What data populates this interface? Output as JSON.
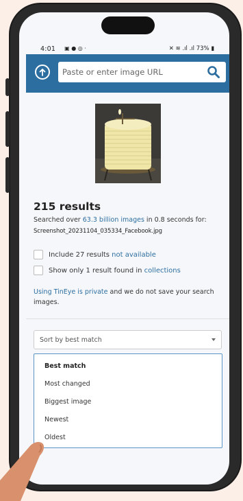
{
  "status_bar": {
    "time": "4:01",
    "battery": "73%"
  },
  "search": {
    "placeholder": "Paste or enter image URL"
  },
  "results": {
    "count_title": "215 results",
    "searched_prefix": "Searched over ",
    "images_link": "63.3 billion images",
    "searched_suffix": " in 0.8 seconds for:",
    "filename": "Screenshot_20231104_035334_Facebook.jpg"
  },
  "filters": {
    "include_prefix": "Include 27 results ",
    "include_link": "not available",
    "only_prefix": "Show only 1 result found in ",
    "only_link": "collections"
  },
  "privacy": {
    "link": "Using TinEye is private",
    "text": " and we do not save your search images."
  },
  "sort": {
    "selected": "Sort by best match",
    "options": [
      "Best match",
      "Most changed",
      "Biggest image",
      "Newest",
      "Oldest"
    ]
  },
  "colors": {
    "accent": "#2d6ea0",
    "background": "#fcefe8"
  },
  "icons": [
    "upload-icon",
    "search-icon",
    "chevron-down-icon"
  ]
}
